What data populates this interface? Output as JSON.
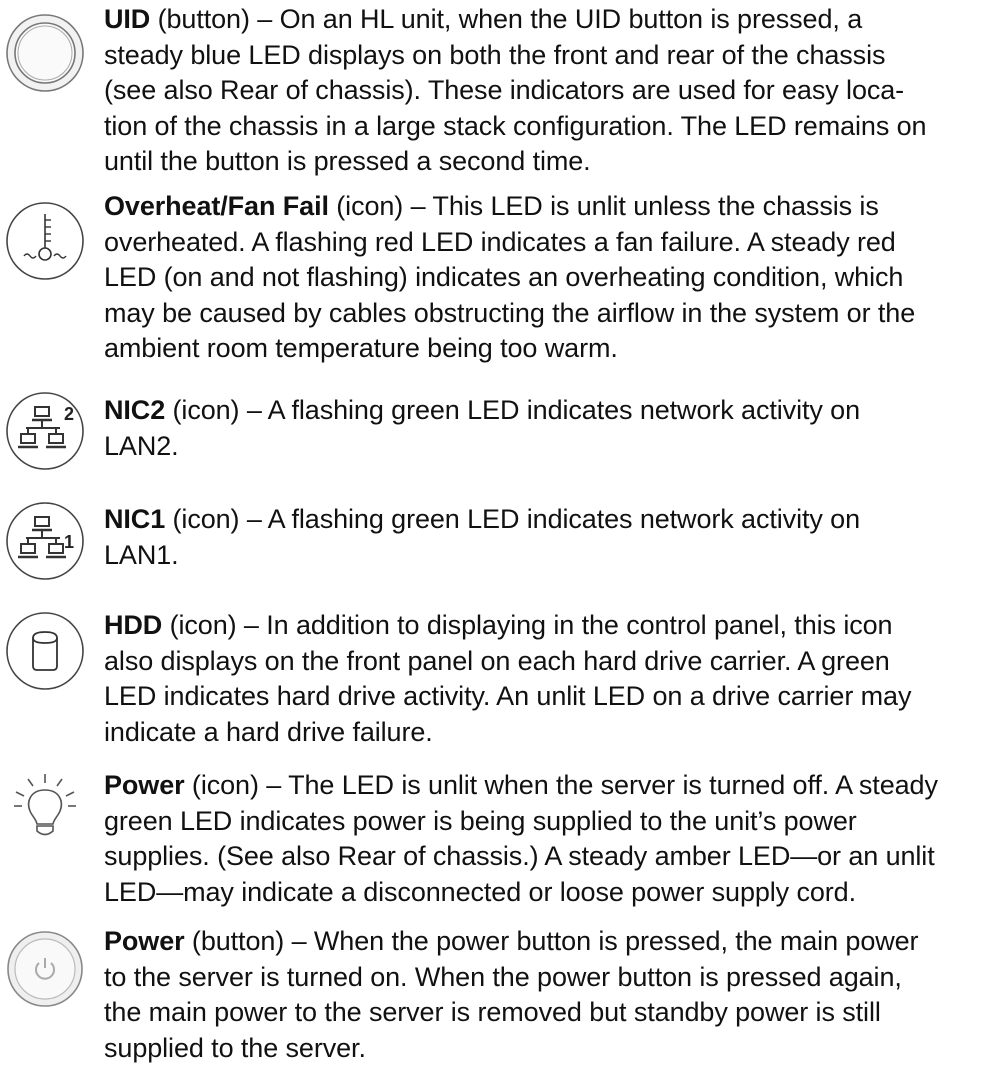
{
  "entries": [
    {
      "icon": "uid-button-icon",
      "title": "UID",
      "kind": " (button)",
      "lines": [
        " – On an HL unit, when the UID button is pressed, a",
        "steady blue LED displays on both the front and rear of the chassis",
        "(see also Rear of chassis). These indicators are used for easy loca-",
        "tion of the chassis in a large stack configuration. The LED remains on",
        "until the button is pressed a second time."
      ]
    },
    {
      "icon": "overheat-fan-fail-icon",
      "title": "Overheat/Fan Fail",
      "kind": " (icon)",
      "lines": [
        " – This LED is unlit unless the chassis is",
        "overheated. A flashing red LED indicates a fan failure. A steady red",
        "LED (on and not flashing) indicates an overheating condition, which",
        "may be caused by cables obstructing the airflow in the system or the",
        "ambient room temperature being too warm."
      ]
    },
    {
      "icon": "nic2-icon",
      "title": "NIC2",
      "kind": " (icon)",
      "lines": [
        " – A flashing green LED indicates network activity on",
        "LAN2."
      ]
    },
    {
      "icon": "nic1-icon",
      "title": "NIC1",
      "kind": " (icon)",
      "lines": [
        " – A flashing green LED indicates network activity on",
        "LAN1."
      ]
    },
    {
      "icon": "hdd-icon",
      "title": "HDD",
      "kind": " (icon)",
      "lines": [
        " – In addition to displaying in the control panel, this icon",
        "also displays on the front panel on each hard drive carrier. A green",
        "LED indicates hard drive activity. An unlit LED on a drive carrier may",
        "indicate a hard drive failure."
      ]
    },
    {
      "icon": "power-led-bulb-icon",
      "title": "Power",
      "kind": " (icon)",
      "lines": [
        " – The LED is unlit when the server is turned off. A steady",
        "green LED indicates power is being supplied to the unit’s power",
        "supplies. (See also Rear of chassis.) A steady amber LED—or an unlit",
        "LED—may indicate a disconnected or loose power supply cord."
      ]
    },
    {
      "icon": "power-button-icon",
      "title": "Power",
      "kind": " (button)",
      "lines": [
        " – When the power button is pressed, the main power",
        "to the server is turned on. When the power button is pressed again,",
        "the main power to the server is removed but standby power is still",
        "supplied to the server."
      ]
    }
  ]
}
